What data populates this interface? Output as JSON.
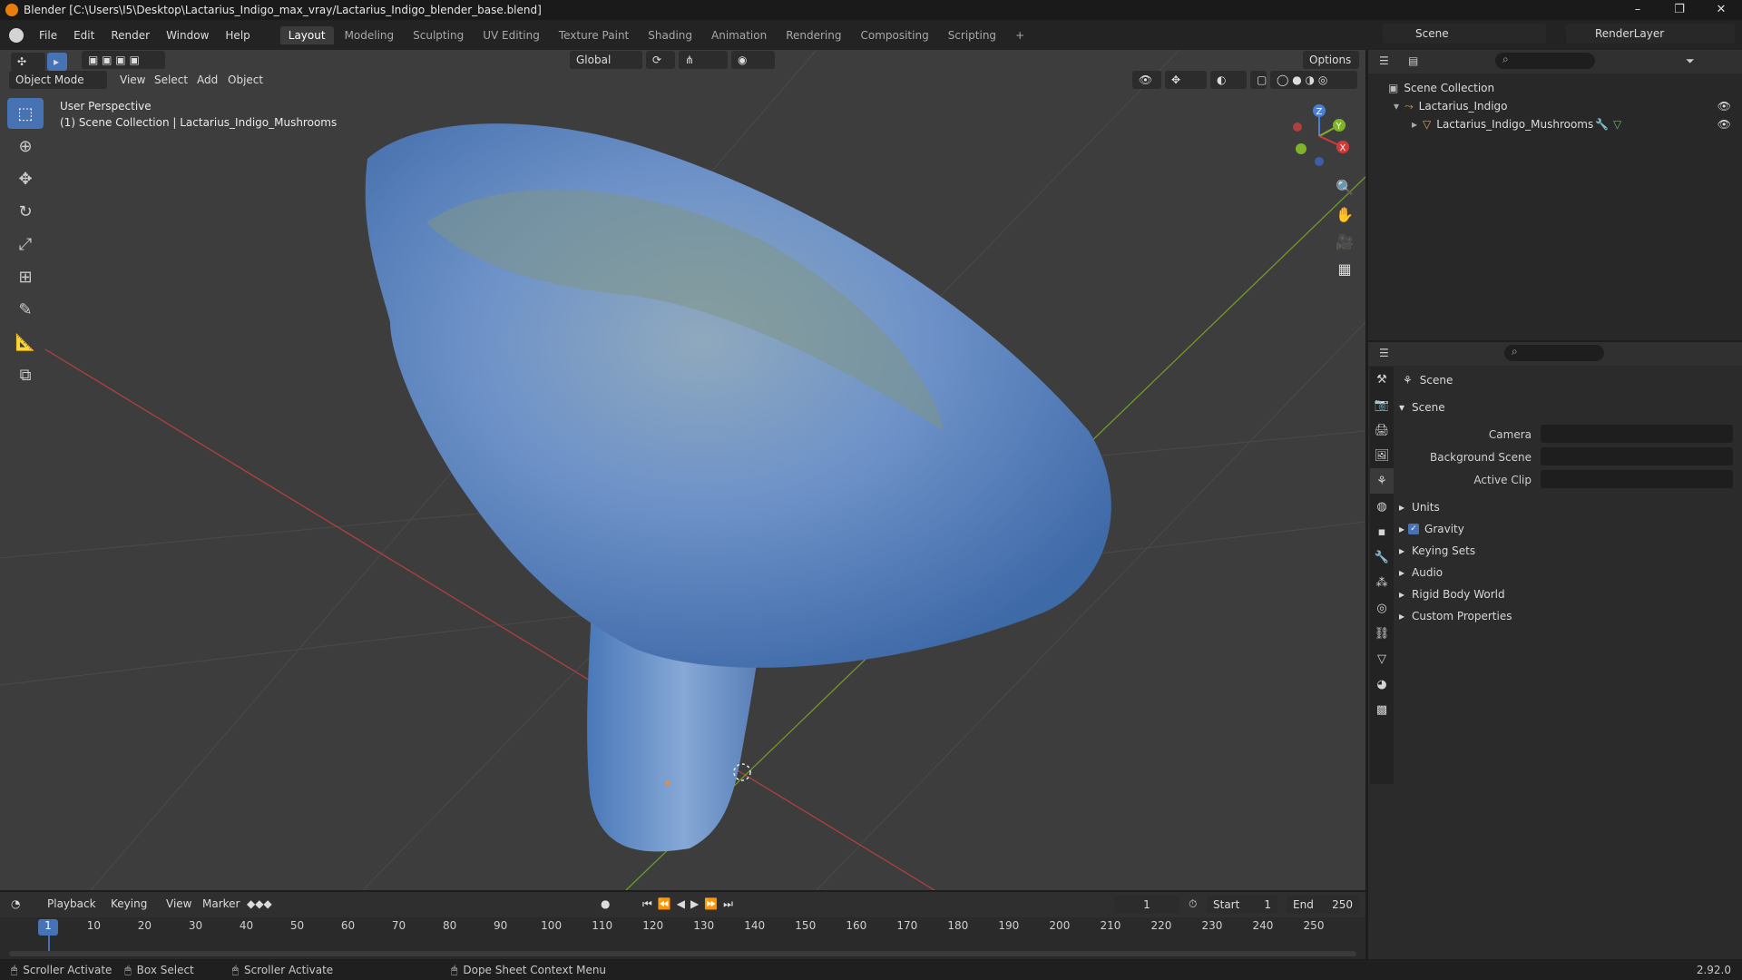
{
  "window": {
    "title": "Blender [C:\\Users\\I5\\Desktop\\Lactarius_Indigo_max_vray/Lactarius_Indigo_blender_base.blend]",
    "min": "–",
    "max": "❐",
    "close": "✕"
  },
  "menu": [
    "File",
    "Edit",
    "Render",
    "Window",
    "Help"
  ],
  "workspaces": [
    "Layout",
    "Modeling",
    "Sculpting",
    "UV Editing",
    "Texture Paint",
    "Shading",
    "Animation",
    "Rendering",
    "Compositing",
    "Scripting"
  ],
  "workspace_add": "+",
  "scene": "Scene",
  "render_layer": "RenderLayer",
  "viewport": {
    "transform": "Global",
    "options": "Options",
    "mode": "Object Mode",
    "menus": [
      "View",
      "Select",
      "Add",
      "Object"
    ],
    "perspective": "User Perspective",
    "collection_info": "(1) Scene Collection | Lactarius_Indigo_Mushrooms"
  },
  "gizmo": {
    "z": "Z",
    "y": "Y",
    "x": "X"
  },
  "outliner": {
    "root": "Scene Collection",
    "collection": "Lactarius_Indigo",
    "object": "Lactarius_Indigo_Mushrooms"
  },
  "properties": {
    "context": "Scene",
    "panel": "Scene",
    "camera_label": "Camera",
    "bg_label": "Background Scene",
    "clip_label": "Active Clip",
    "sections": [
      "Units",
      "Gravity",
      "Keying Sets",
      "Audio",
      "Rigid Body World",
      "Custom Properties"
    ]
  },
  "timeline": {
    "menus": [
      "Playback",
      "Keying",
      "View",
      "Marker"
    ],
    "current_frame": "1",
    "start_label": "Start",
    "start": "1",
    "end_label": "End",
    "end": "250",
    "ticks": [
      "1",
      "10",
      "20",
      "30",
      "40",
      "50",
      "60",
      "70",
      "80",
      "90",
      "100",
      "110",
      "120",
      "130",
      "140",
      "150",
      "160",
      "170",
      "180",
      "190",
      "200",
      "210",
      "220",
      "230",
      "240",
      "250"
    ]
  },
  "status": {
    "left1": "Scroller Activate",
    "left2": "Box Select",
    "left3": "Scroller Activate",
    "ctx": "Dope Sheet Context Menu",
    "version": "2.92.0"
  },
  "colors": {
    "accent": "#4772b3",
    "x_axis": "#d23a3a",
    "y_axis": "#7fb32a",
    "mushroom": "#6f93c9"
  }
}
